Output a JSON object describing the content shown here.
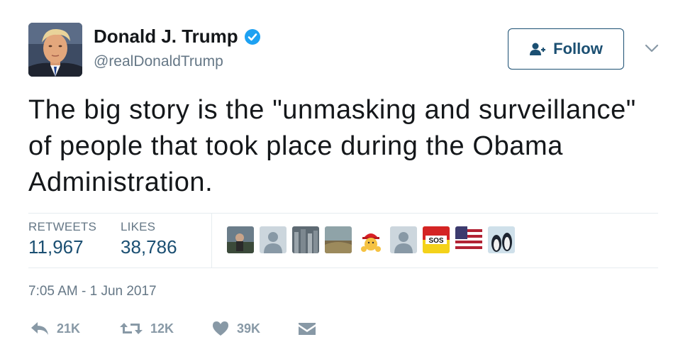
{
  "user": {
    "display_name": "Donald J. Trump",
    "handle": "@realDonaldTrump",
    "verified_icon": "verified-badge-icon"
  },
  "follow_button": {
    "label": "Follow",
    "icon": "add-user-icon"
  },
  "menu_icon": "chevron-down-icon",
  "tweet": {
    "text": "The big story is the \"unmasking and surveillance\" of people that took place during the Obama Administration."
  },
  "stats": {
    "retweets_label": "RETWEETS",
    "retweets_value": "11,967",
    "likes_label": "LIKES",
    "likes_value": "38,786"
  },
  "liker_avatars": [
    "avatar-1",
    "avatar-2",
    "avatar-3",
    "avatar-4",
    "avatar-5",
    "avatar-6",
    "avatar-7",
    "avatar-8",
    "avatar-9"
  ],
  "timestamp": "7:05 AM - 1 Jun 2017",
  "actions": {
    "reply_count": "21K",
    "retweet_count": "12K",
    "like_count": "39K"
  },
  "colors": {
    "text": "#14171a",
    "secondary": "#657786",
    "accent": "#1b4f72",
    "verified": "#1da1f2",
    "action_gray": "#8899a6"
  }
}
